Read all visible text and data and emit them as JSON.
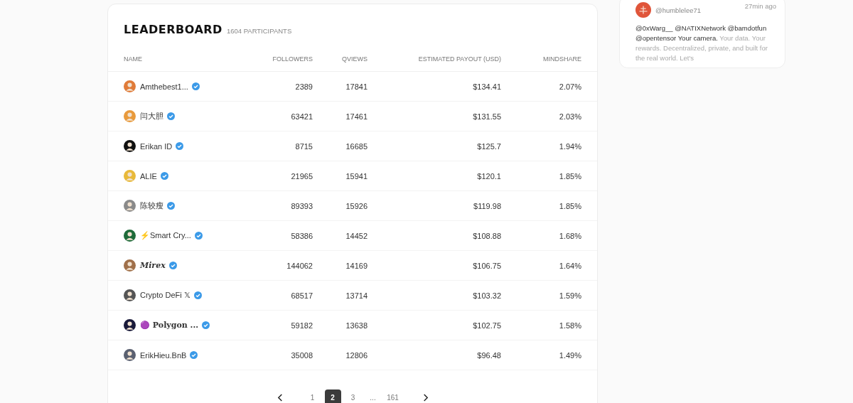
{
  "leaderboard": {
    "title": "LEADERBOARD",
    "participants": "1604 PARTICIPANTS",
    "columns": [
      "NAME",
      "FOLLOWERS",
      "QVIEWS",
      "ESTIMATED PAYOUT (USD)",
      "MINDSHARE"
    ],
    "rows": [
      {
        "name": "Amthebest1...",
        "kind": "plain",
        "color": "#e07b39",
        "followers": "2389",
        "qviews": "17841",
        "payout": "$134.41",
        "mindshare": "2.07%"
      },
      {
        "name": "闫大胆",
        "kind": "plain",
        "color": "#e89a3c",
        "followers": "63421",
        "qviews": "17461",
        "payout": "$131.55",
        "mindshare": "2.03%"
      },
      {
        "name": "Erikan ID",
        "kind": "plain",
        "color": "#111111",
        "followers": "8715",
        "qviews": "16685",
        "payout": "$125.7",
        "mindshare": "1.94%"
      },
      {
        "name": "ALIE",
        "kind": "plain",
        "color": "#e8b93a",
        "followers": "21965",
        "qviews": "15941",
        "payout": "$120.1",
        "mindshare": "1.85%"
      },
      {
        "name": "陈较瘦",
        "kind": "plain",
        "color": "#8a8a8a",
        "followers": "89393",
        "qviews": "15926",
        "payout": "$119.98",
        "mindshare": "1.85%"
      },
      {
        "name": "⚡Smart Cry...",
        "kind": "plain",
        "color": "#1f6b3a",
        "followers": "58386",
        "qviews": "14452",
        "payout": "$108.88",
        "mindshare": "1.68%"
      },
      {
        "name": "Mirex",
        "kind": "serif-bold-italic",
        "color": "#a0704a",
        "followers": "144062",
        "qviews": "14169",
        "payout": "$106.75",
        "mindshare": "1.64%"
      },
      {
        "name": "Crypto DeFi 𝕏",
        "kind": "plain",
        "color": "#555555",
        "followers": "68517",
        "qviews": "13714",
        "payout": "$103.32",
        "mindshare": "1.59%"
      },
      {
        "name": "🟣 Polygon ...",
        "kind": "serif-bold",
        "color": "#1a1a3a",
        "followers": "59182",
        "qviews": "13638",
        "payout": "$102.75",
        "mindshare": "1.58%"
      },
      {
        "name": "ErikHieu.BnB",
        "kind": "plain",
        "color": "#5a6070",
        "followers": "35008",
        "qviews": "12806",
        "payout": "$96.48",
        "mindshare": "1.49%"
      }
    ],
    "pages": [
      {
        "label": "1",
        "selected": false
      },
      {
        "label": "2",
        "selected": true
      },
      {
        "label": "3",
        "selected": false
      },
      {
        "label": "...",
        "selected": false
      },
      {
        "label": "161",
        "selected": false
      }
    ]
  },
  "tweet": {
    "handle": "@humblelee71",
    "time": "27min ago",
    "text_lead": "@0xWarg__ @NATIXNetwork @bamdotfun @opentensor Your camera.",
    "text_faded": "Your data. Your rewards. Decentralized, private, and built for the real world. Let's"
  }
}
